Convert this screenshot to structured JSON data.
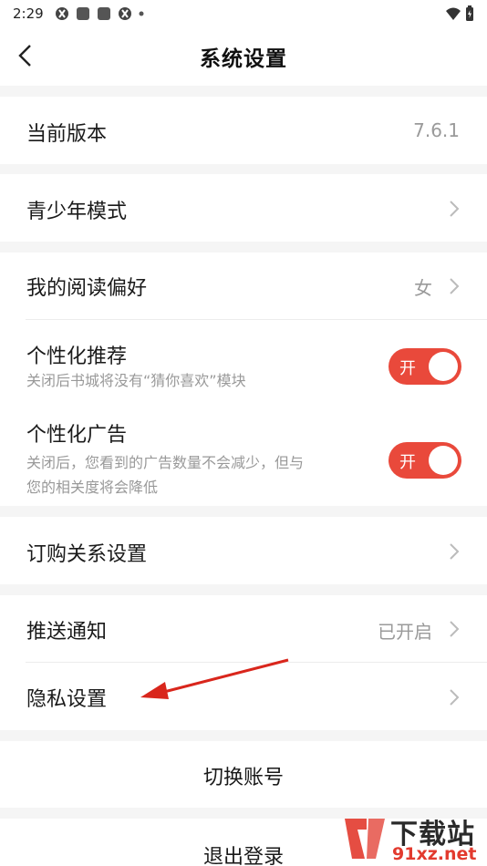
{
  "status_bar": {
    "time": "2:29"
  },
  "nav": {
    "title": "系统设置"
  },
  "version": {
    "label": "当前版本",
    "value": "7.6.1"
  },
  "youth_mode": {
    "label": "青少年模式"
  },
  "reading_pref": {
    "label": "我的阅读偏好",
    "value": "女"
  },
  "personal_recommend": {
    "label": "个性化推荐",
    "desc": "关闭后书城将没有“猜你喜欢”模块",
    "toggle_label": "开",
    "enabled": true
  },
  "personal_ads": {
    "label": "个性化广告",
    "desc_line1": "关闭后，您看到的广告数量不会减少，但与",
    "desc_line2": "您的相关度将会降低",
    "toggle_label": "开",
    "enabled": true
  },
  "subscription": {
    "label": "订购关系设置"
  },
  "push": {
    "label": "推送通知",
    "value": "已开启"
  },
  "privacy": {
    "label": "隐私设置"
  },
  "switch_account": {
    "label": "切换账号"
  },
  "logout": {
    "label": "退出登录"
  },
  "watermark": {
    "text": "下载站",
    "url": "91xz.net"
  },
  "colors": {
    "accent": "#e9493b",
    "background": "#f5f5f5",
    "annotation_arrow": "#d9261c"
  }
}
